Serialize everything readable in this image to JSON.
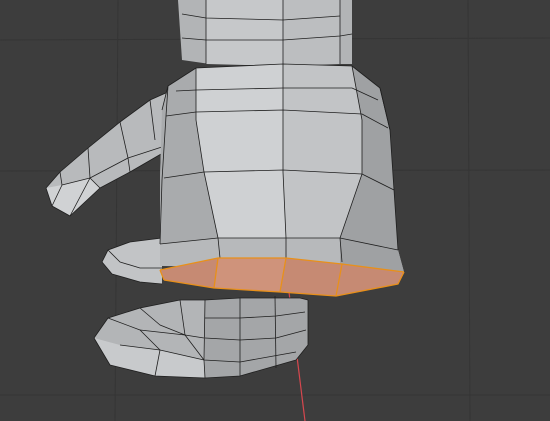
{
  "app": {
    "view": "3d-viewport",
    "mode": "edit-mode",
    "selection": "face-loop"
  },
  "colors": {
    "background": "#3d3d3d",
    "grid_line": "#353535",
    "mesh_light": "#c9cbcd",
    "mesh_mid": "#b4b6b8",
    "mesh_dark": "#8f9193",
    "mesh_edge": "#1f1f1f",
    "selected_face": "#c68a73",
    "selected_edge": "#e8901a",
    "axis_x": "#d6474e"
  }
}
